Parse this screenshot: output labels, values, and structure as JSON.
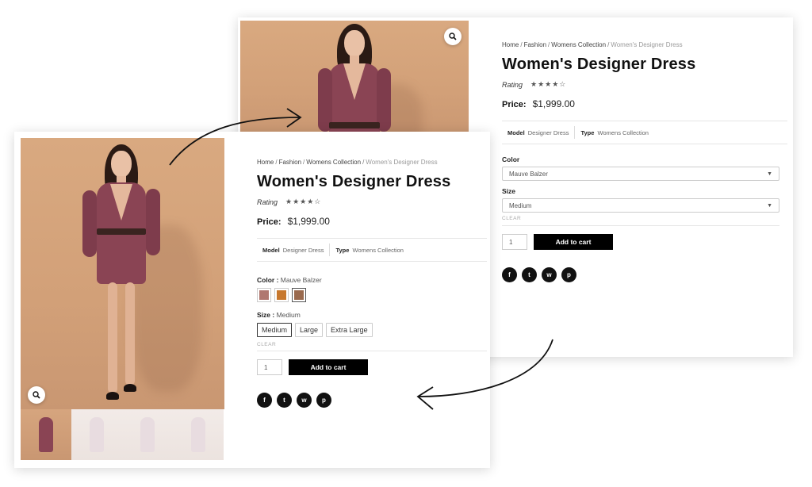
{
  "product": {
    "breadcrumb": [
      "Home",
      "Fashion",
      "Womens Collection",
      "Women's Designer Dress"
    ],
    "title": "Women's Designer Dress",
    "rating_label": "Rating",
    "stars": "★★★★☆",
    "rating_value": 4,
    "price_label": "Price:",
    "price": "$1,999.00",
    "meta": [
      {
        "key": "Model",
        "value": "Designer Dress"
      },
      {
        "key": "Type",
        "value": "Womens Collection"
      }
    ]
  },
  "layout_dropdown": {
    "color_label": "Color",
    "color_selected": "Mauve Balzer",
    "size_label": "Size",
    "size_selected": "Medium",
    "clear_label": "CLEAR",
    "quantity": "1",
    "add_to_cart": "Add to cart"
  },
  "layout_swatches": {
    "color_label": "Color",
    "color_selected": "Mauve Balzer",
    "swatch_colors": [
      "#b07870",
      "#c7782e",
      "#9a6a4e"
    ],
    "active_swatch": 2,
    "size_label": "Size",
    "size_selected": "Medium",
    "sizes": [
      "Medium",
      "Large",
      "Extra Large"
    ],
    "active_size": 0,
    "clear_label": "CLEAR",
    "quantity": "1",
    "add_to_cart": "Add to cart"
  },
  "social_icons": [
    "facebook-icon",
    "twitter-icon",
    "whatsapp-icon",
    "pinterest-icon"
  ],
  "social_glyphs": [
    "f",
    "t",
    "w",
    "p"
  ],
  "colors": {
    "coat": "#8a4454",
    "background": "#d2a078",
    "button": "#000000"
  }
}
